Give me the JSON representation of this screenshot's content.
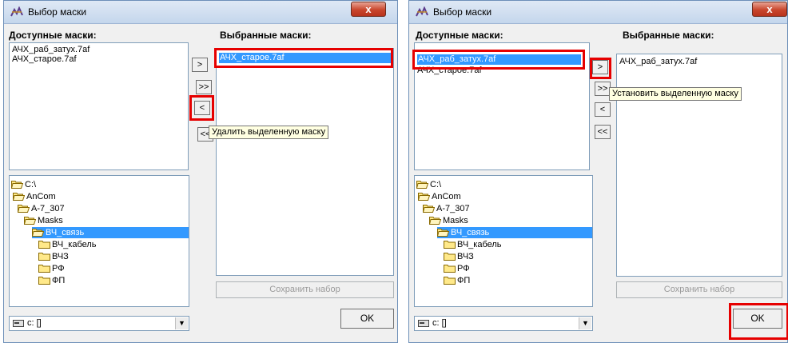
{
  "dialogs": [
    {
      "title": "Выбор маски",
      "close_glyph": "x",
      "available_label": "Доступные маски:",
      "selected_label": "Выбранные маски:",
      "available_items": [
        "АЧХ_раб_затух.7af",
        "АЧХ_старое.7af"
      ],
      "selected_items": [
        "АЧХ_старое.7af"
      ],
      "move_buttons": [
        ">",
        ">>",
        "<",
        "<<"
      ],
      "tooltip": "Удалить выделенную маску",
      "tree": [
        "C:\\",
        "AnCom",
        "A-7_307",
        "Masks",
        "ВЧ_связь",
        "ВЧ_кабель",
        "ВЧЗ",
        "РФ",
        "ФП"
      ],
      "tree_selected": "ВЧ_связь",
      "drive_value": "c: []",
      "save_button": "Сохранить набор",
      "ok_button": "OK"
    },
    {
      "title": "Выбор маски",
      "close_glyph": "x",
      "available_label": "Доступные маски:",
      "selected_label": "Выбранные маски:",
      "available_items": [
        "АЧХ_раб_затух.7af",
        "АЧХ_старое.7af"
      ],
      "selected_items": [
        "АЧХ_раб_затух.7af"
      ],
      "move_buttons": [
        ">",
        ">>",
        "<",
        "<<"
      ],
      "tooltip": "Установить выделенную маску",
      "tree": [
        "C:\\",
        "AnCom",
        "A-7_307",
        "Masks",
        "ВЧ_связь",
        "ВЧ_кабель",
        "ВЧЗ",
        "РФ",
        "ФП"
      ],
      "tree_selected": "ВЧ_связь",
      "drive_value": "c: []",
      "save_button": "Сохранить набор",
      "ok_button": "OK"
    }
  ],
  "colors": {
    "highlight": "#3399ff",
    "annotation": "#e60000",
    "tooltip_bg": "#ffffe1"
  },
  "icons": [
    "app-icon",
    "close-icon",
    "folder-open-icon",
    "folder-closed-icon",
    "drive-icon",
    "dropdown-arrow-icon"
  ]
}
